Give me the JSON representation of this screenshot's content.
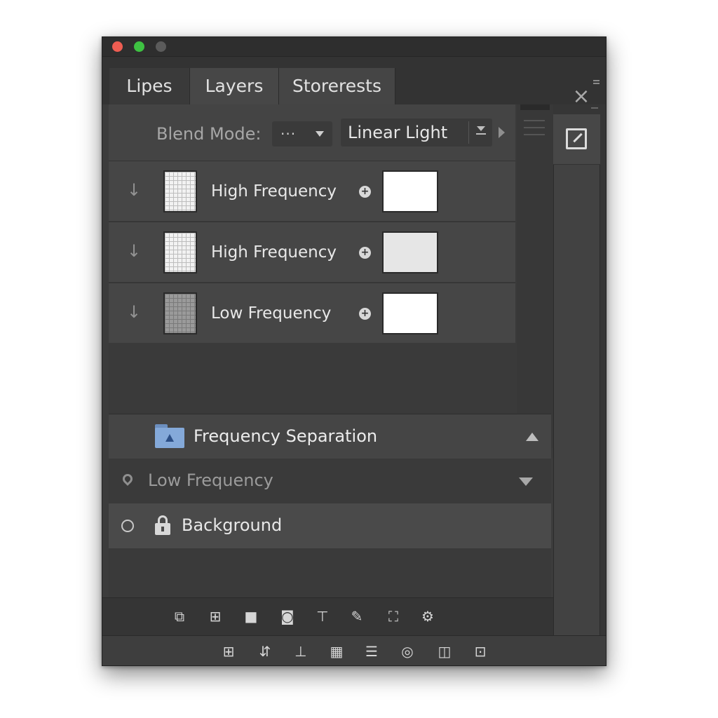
{
  "window": {
    "controls": [
      "close",
      "zoom",
      "minimize"
    ]
  },
  "tabs": [
    {
      "label": "Lipes"
    },
    {
      "label": "Layers"
    },
    {
      "label": "Storerests"
    }
  ],
  "close_glyph": "×",
  "blend": {
    "label": "Blend Mode:",
    "options_glyph": "···",
    "value": "Linear Light"
  },
  "layers": [
    {
      "name": "High Frequency",
      "link_glyph": "+"
    },
    {
      "name": "High Frequency",
      "link_glyph": "+"
    },
    {
      "name": "Low Frequency",
      "link_glyph": "+"
    }
  ],
  "group": {
    "name": "Frequency Separation"
  },
  "low_frequency_row": {
    "label": "Low Frequency"
  },
  "background_row": {
    "label": "Background"
  },
  "layer_arrow_glyph": "↓",
  "icons": {
    "side_panel": "edit-square-icon",
    "group": "folder-icon",
    "locked": "lock-icon",
    "pin": "pin-icon",
    "visibility": "circle-icon"
  },
  "colors": {
    "folder": "#84a9d9",
    "close_dot": "#ee5d52",
    "zoom_dot": "#3ec142",
    "panel_bg": "#3c3c3c"
  },
  "toolbar_top": [
    {
      "name": "duplicate-layer-icon",
      "glyph": "⧉"
    },
    {
      "name": "add-layer-icon",
      "glyph": "⊞"
    },
    {
      "name": "mask-icon",
      "glyph": "■"
    },
    {
      "name": "adjustment-icon",
      "glyph": "◙"
    },
    {
      "name": "text-layer-icon",
      "glyph": "⊤"
    },
    {
      "name": "brush-icon",
      "glyph": "✎"
    },
    {
      "name": "crop-icon",
      "glyph": "⛶"
    },
    {
      "name": "settings-icon",
      "glyph": "⚙"
    }
  ],
  "toolbar_bottom": [
    {
      "name": "group-icon",
      "glyph": "⊞"
    },
    {
      "name": "merge-down-icon",
      "glyph": "⇵"
    },
    {
      "name": "align-icon",
      "glyph": "⊥"
    },
    {
      "name": "grid-icon",
      "glyph": "▦"
    },
    {
      "name": "list-icon",
      "glyph": "☰"
    },
    {
      "name": "target-icon",
      "glyph": "◎"
    },
    {
      "name": "split-icon",
      "glyph": "◫"
    },
    {
      "name": "export-icon",
      "glyph": "⊡"
    }
  ]
}
